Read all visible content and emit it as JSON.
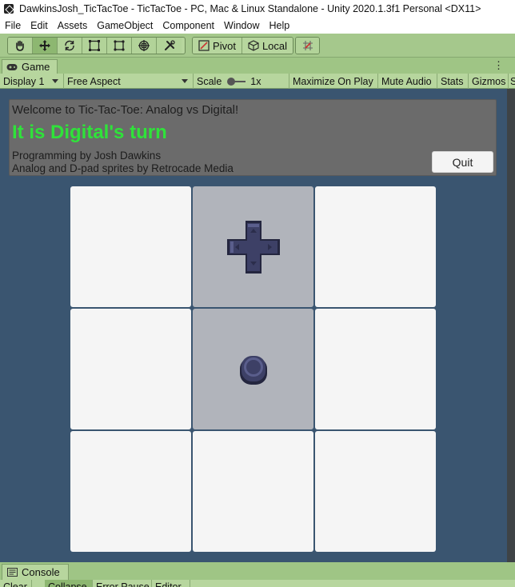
{
  "window": {
    "title": "DawkinsJosh_TicTacToe - TicTacToe - PC, Mac & Linux Standalone - Unity 2020.1.3f1 Personal <DX11>"
  },
  "menu": [
    "File",
    "Edit",
    "Assets",
    "GameObject",
    "Component",
    "Window",
    "Help"
  ],
  "toolbar": {
    "tools": [
      "hand-icon",
      "move-icon",
      "rotate-icon",
      "scale-icon",
      "rect-transform-icon",
      "transform-icon",
      "custom-tool-icon"
    ],
    "active_tool": "move-icon",
    "pivot_label": "Pivot",
    "local_label": "Local"
  },
  "game_tab": {
    "label": "Game",
    "menu_glyph": "⋮"
  },
  "game_toolbar": {
    "display": "Display 1",
    "aspect": "Free Aspect",
    "scale_label": "Scale",
    "scale_value": "1x",
    "maximize": "Maximize On Play",
    "mute": "Mute Audio",
    "stats": "Stats",
    "gizmos": "Gizmos",
    "gizmos_cut": "S"
  },
  "banner": {
    "welcome": "Welcome to Tic-Tac-Toe: Analog vs Digital!",
    "turn": "It is Digital's turn",
    "credit1": "Programming by Josh Dawkins",
    "credit2": "Analog and D-pad sprites by Retrocade Media",
    "quit": "Quit"
  },
  "board": {
    "cells": [
      "",
      "dpad",
      "",
      "",
      "analog",
      "",
      "",
      "",
      ""
    ],
    "highlighted": [
      1,
      4
    ],
    "colors": {
      "piece": "#3d4066",
      "piece_dark": "#24263f",
      "piece_light": "#5a5e8c"
    }
  },
  "console": {
    "tab": "Console",
    "buttons": [
      "Clear",
      "Collapse",
      "Error Pause",
      "Editor"
    ]
  }
}
